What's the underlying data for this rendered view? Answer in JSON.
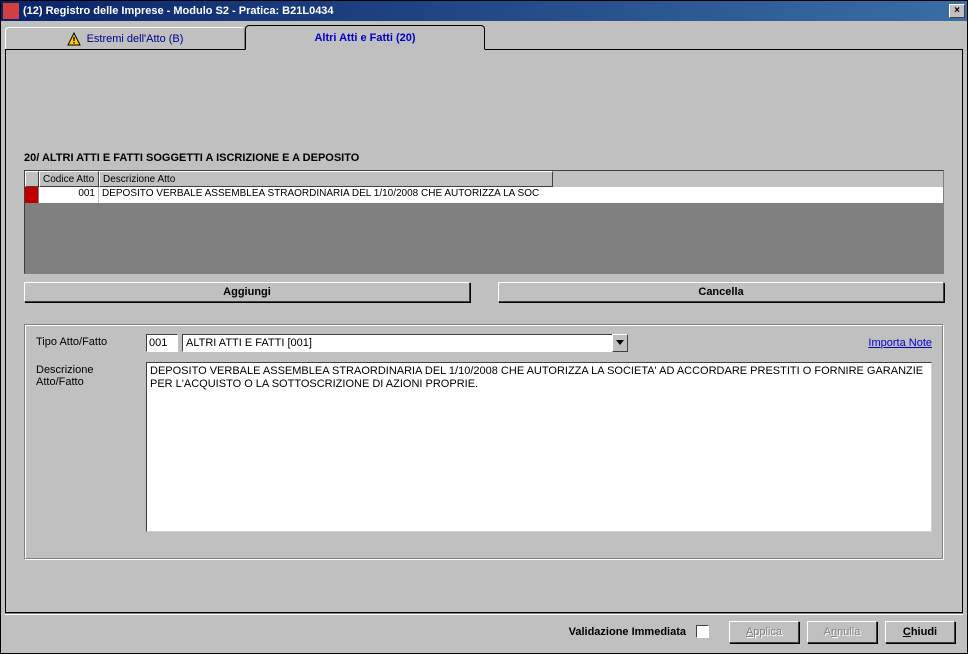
{
  "titlebar": {
    "text": "(12) Registro delle Imprese - Modulo S2 - Pratica: B21L0434"
  },
  "tabs": {
    "tab1_label": "Estremi dell'Atto (B)",
    "tab2_label": "Altri Atti e Fatti (20)"
  },
  "section": {
    "heading": "20/ ALTRI ATTI E FATTI SOGGETTI A ISCRIZIONE E A DEPOSITO"
  },
  "grid": {
    "headers": {
      "codice": "Codice Atto",
      "descrizione": "Descrizione Atto"
    },
    "rows": [
      {
        "codice": "001",
        "descrizione": "DEPOSITO VERBALE ASSEMBLEA STRAORDINARIA DEL 1/10/2008 CHE AUTORIZZA LA SOC"
      }
    ]
  },
  "buttons": {
    "aggiungi": "Aggiungi",
    "cancella": "Cancella"
  },
  "form": {
    "tipo_label": "Tipo Atto/Fatto",
    "tipo_code": "001",
    "tipo_desc": "ALTRI ATTI E FATTI [001]",
    "importa_note": "Importa Note",
    "descrizione_label": "Descrizione Atto/Fatto",
    "descrizione_text": "DEPOSITO VERBALE ASSEMBLEA STRAORDINARIA DEL 1/10/2008 CHE AUTORIZZA LA SOCIETA' AD ACCORDARE PRESTITI O FORNIRE GARANZIE PER L'ACQUISTO O LA SOTTOSCRIZIONE DI AZIONI PROPRIE."
  },
  "bottombar": {
    "validazione": "Validazione Immediata",
    "applica": "pplica",
    "applica_ul": "A",
    "annulla_pre": "A",
    "annulla_ul": "n",
    "annulla_post": "nulla",
    "chiudi_ul": "C",
    "chiudi_post": "hiudi"
  }
}
